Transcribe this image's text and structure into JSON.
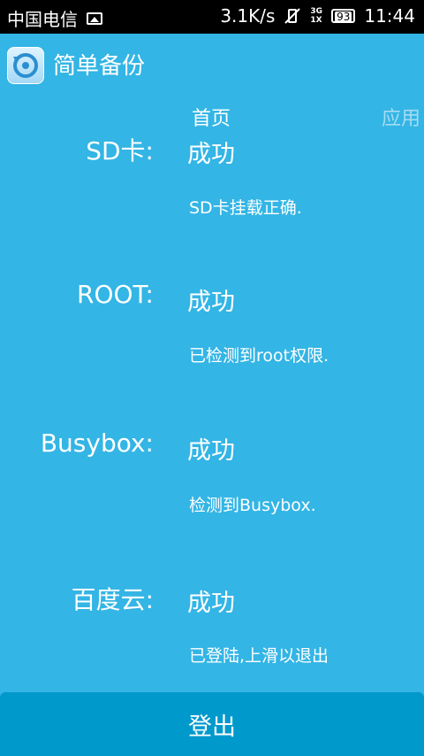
{
  "status_bar": {
    "carrier": "中国电信",
    "speed": "3.1K/s",
    "network_top": "3G",
    "network_bottom": "1X",
    "battery": "93",
    "time": "11:44"
  },
  "app": {
    "title": "简单备份"
  },
  "tabs": [
    {
      "label": "首页"
    },
    {
      "label": "应用"
    }
  ],
  "rows": [
    {
      "label": "SD卡:",
      "status": "成功",
      "detail": "SD卡挂载正确."
    },
    {
      "label": "ROOT:",
      "status": "成功",
      "detail": "已检测到root权限."
    },
    {
      "label": "Busybox:",
      "status": "成功",
      "detail": "检测到Busybox."
    },
    {
      "label": "百度云:",
      "status": "成功",
      "detail": "已登陆,上滑以退出"
    }
  ],
  "logout_button": {
    "label": "登出"
  },
  "colors": {
    "background": "#33b5e5",
    "button": "#0099cc",
    "inactive_tab": "#a6dcf2"
  }
}
